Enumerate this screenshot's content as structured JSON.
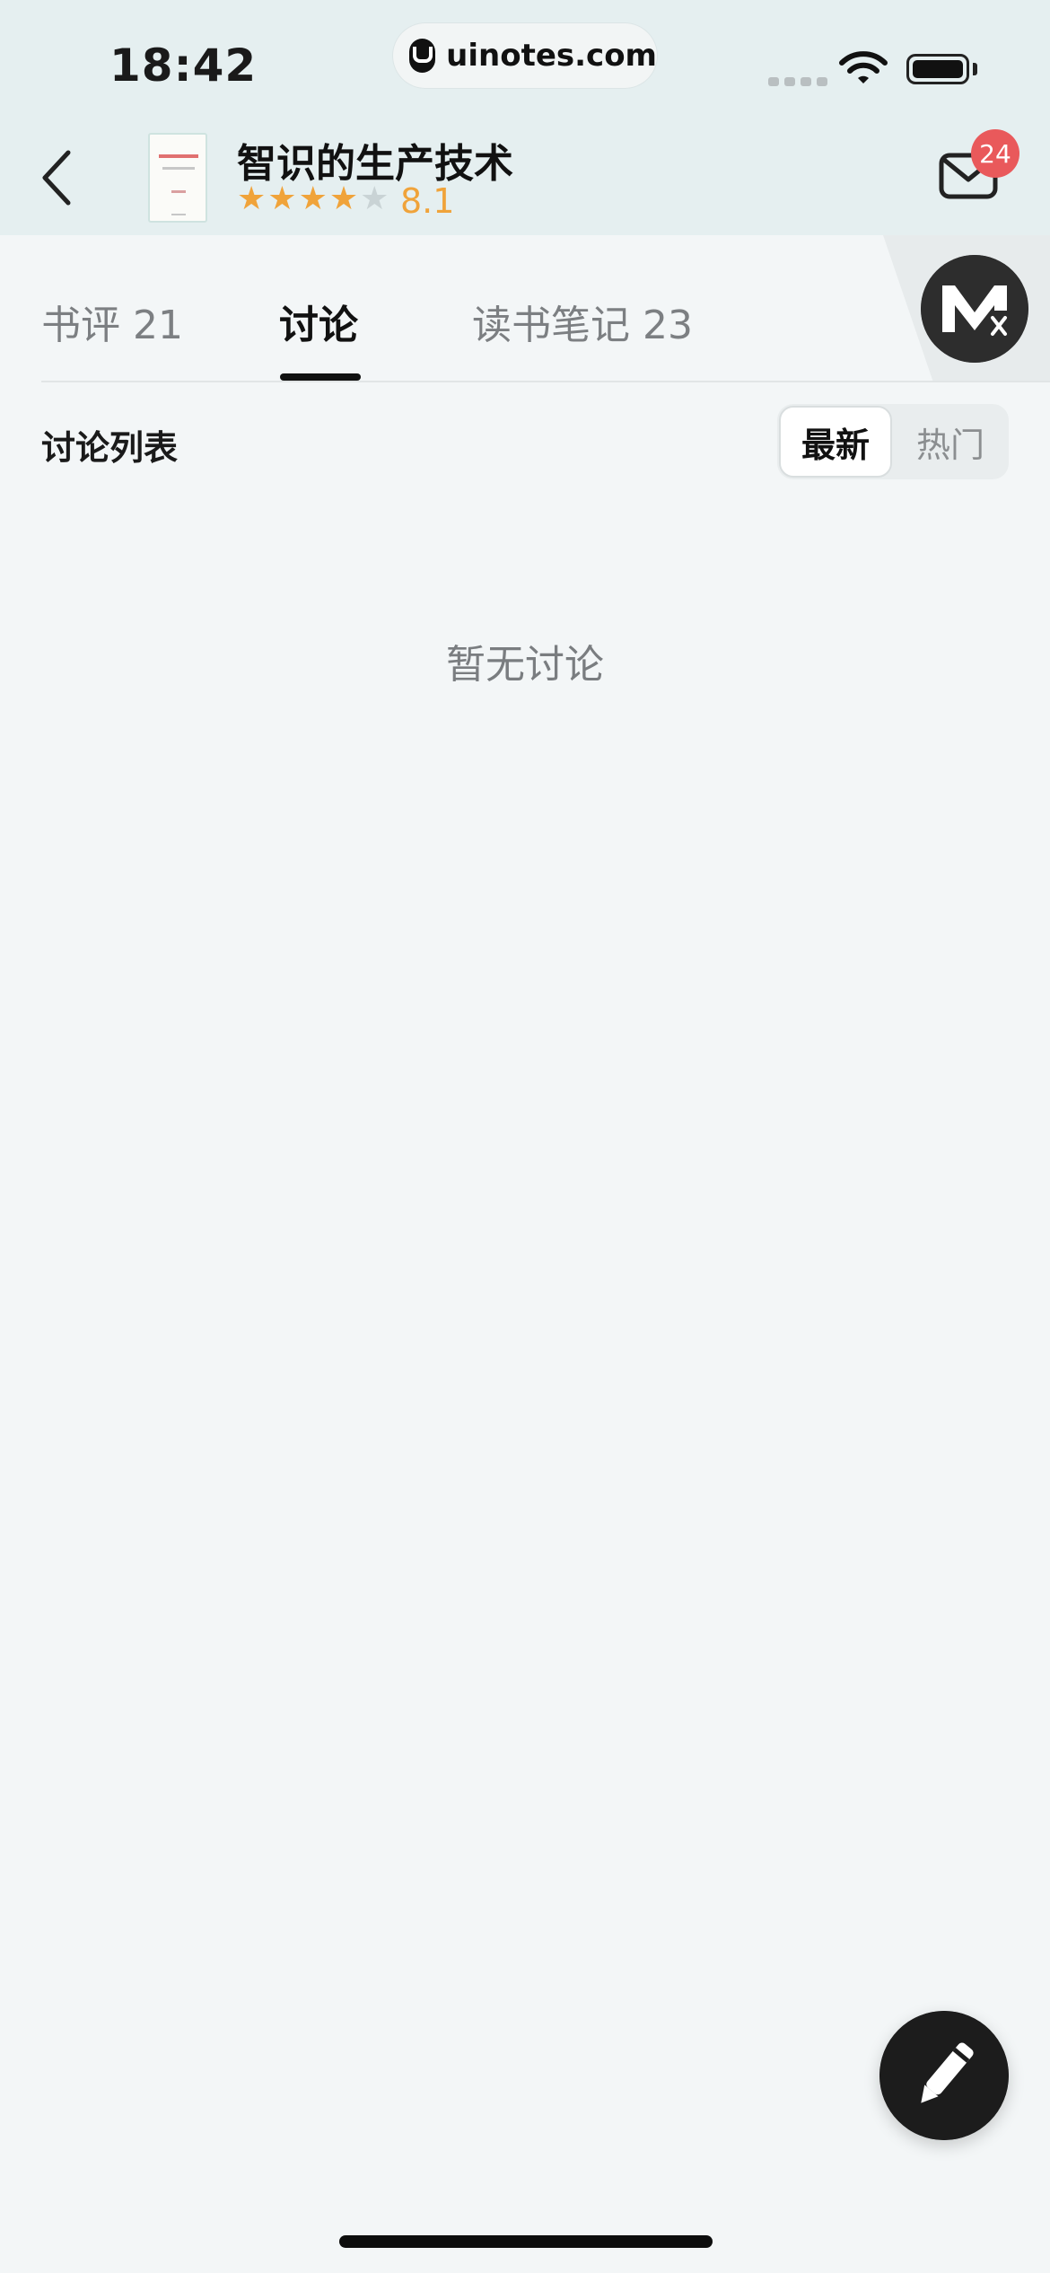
{
  "status_bar": {
    "time": "18:42",
    "url": "uinotes.com"
  },
  "book": {
    "title": "智识的生产技术",
    "rating": "8.1",
    "stars_filled": 4,
    "stars_total": 5
  },
  "inbox": {
    "badge_count": "24"
  },
  "tabs": [
    {
      "label": "书评 21",
      "active": false
    },
    {
      "label": "讨论",
      "active": true
    },
    {
      "label": "读书笔记 23",
      "active": false
    }
  ],
  "discussion": {
    "list_title": "讨论列表",
    "sort_options": [
      "最新",
      "热门"
    ],
    "selected_sort": "最新",
    "empty_message": "暂无讨论"
  },
  "colors": {
    "accent": "#f0a33a",
    "badge": "#e9595b",
    "star_empty": "#c9d3d5"
  },
  "icons": {
    "back": "chevron-left-icon",
    "mail": "mail-icon",
    "compose": "pen-icon",
    "avatar": "mx-logo"
  }
}
